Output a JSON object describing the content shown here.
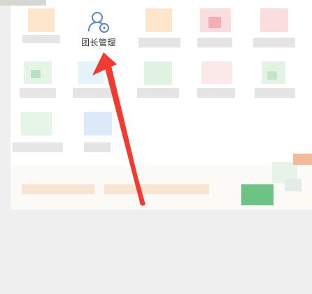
{
  "menu": {
    "team_manage_label": "团长管理"
  },
  "icons": {
    "team_manage": "user-settings-icon"
  },
  "colors": {
    "icon_blue": "#5a86c8",
    "arrow_red": "#f23a30",
    "label_text": "#333333"
  }
}
